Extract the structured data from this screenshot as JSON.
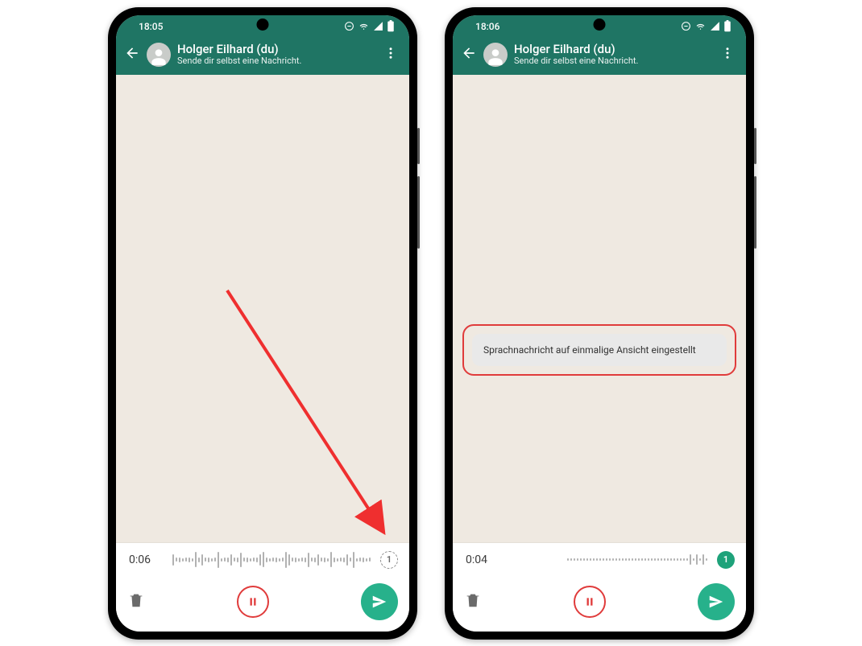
{
  "phoneLeft": {
    "statusTime": "18:05",
    "headerTitle": "Holger Eilhard (du)",
    "headerSub": "Sende dir selbst eine Nachricht.",
    "timer": "0:06",
    "viewOnceNumber": "1",
    "viewOnceActive": false,
    "waveformCount": 62,
    "waveformDense": true
  },
  "phoneRight": {
    "statusTime": "18:06",
    "headerTitle": "Holger Eilhard (du)",
    "headerSub": "Sende dir selbst eine Nachricht.",
    "timer": "0:04",
    "viewOnceNumber": "1",
    "viewOnceActive": true,
    "waveformCount": 44,
    "waveformDense": false,
    "toastText": "Sprachnachricht auf einmalige Ansicht eingestellt"
  },
  "icons": {
    "back": "back-arrow-icon",
    "avatar": "avatar-icon",
    "kebab": "kebab-icon",
    "trash": "trash-icon",
    "pause": "pause-icon",
    "send": "send-icon",
    "wifi": "wifi-icon",
    "signal": "signal-icon",
    "battery": "battery-icon",
    "minus": "minus-circle-icon"
  }
}
